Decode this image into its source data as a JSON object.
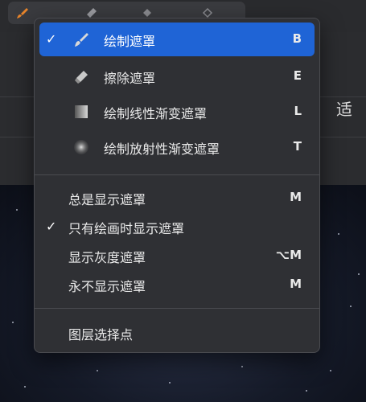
{
  "background": {
    "fit_label": "适"
  },
  "menu": {
    "groups": [
      {
        "items": [
          {
            "label": "绘制遮罩",
            "shortcut": "B",
            "checked": "✓",
            "icon": "brush-icon",
            "selected": true
          },
          {
            "label": "擦除遮罩",
            "shortcut": "E",
            "checked": "",
            "icon": "eraser-icon",
            "selected": false
          },
          {
            "label": "绘制线性渐变遮罩",
            "shortcut": "L",
            "checked": "",
            "icon": "linear-gradient-icon",
            "selected": false
          },
          {
            "label": "绘制放射性渐变遮罩",
            "shortcut": "T",
            "checked": "",
            "icon": "radial-gradient-icon",
            "selected": false
          }
        ]
      },
      {
        "items": [
          {
            "label": "总是显示遮罩",
            "shortcut": "M",
            "checked": ""
          },
          {
            "label": "只有绘画时显示遮罩",
            "shortcut": "",
            "checked": "✓"
          },
          {
            "label": "显示灰度遮罩",
            "shortcut": "⌥M",
            "checked": ""
          },
          {
            "label": "永不显示遮罩",
            "shortcut": "M",
            "checked": ""
          }
        ]
      },
      {
        "items": [
          {
            "label": "图层选择点",
            "shortcut": "",
            "checked": ""
          }
        ]
      }
    ]
  },
  "colors": {
    "selection": "#1f64d6",
    "menu_bg": "#2f3034",
    "brush_accent": "#e8852b"
  }
}
